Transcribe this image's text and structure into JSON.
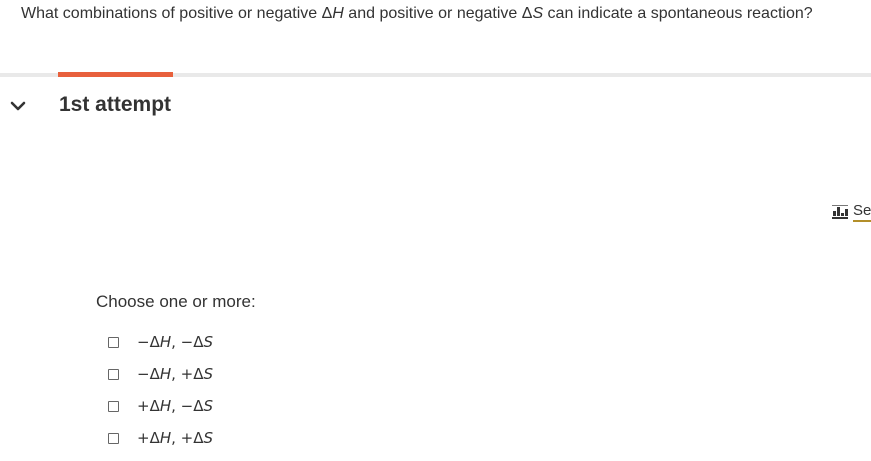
{
  "question": {
    "part1": "What combinations of positive or negative Δ",
    "var_h": "H",
    "part2": " and positive or negative Δ",
    "var_s": "S",
    "part3": " can indicate a spontaneous reaction?"
  },
  "attempt": {
    "title": "1st attempt",
    "expanded_icon": "chevron-down-icon"
  },
  "side_link": {
    "label": "Se",
    "icon": "chart-icon"
  },
  "choices": {
    "instruction": "Choose one or more:",
    "options": [
      {
        "sign_h": "−Δ",
        "h": "H",
        "sep": ", ",
        "sign_s": "−Δ",
        "s": "S",
        "checked": false
      },
      {
        "sign_h": "−Δ",
        "h": "H",
        "sep": ", ",
        "sign_s": "+Δ",
        "s": "S",
        "checked": false
      },
      {
        "sign_h": "+Δ",
        "h": "H",
        "sep": ", ",
        "sign_s": "−Δ",
        "s": "S",
        "checked": false
      },
      {
        "sign_h": "+Δ",
        "h": "H",
        "sep": ", ",
        "sign_s": "+Δ",
        "s": "S",
        "checked": false
      }
    ]
  },
  "colors": {
    "accent": "#e8603c",
    "divider": "#e9e9e9",
    "link_underline": "#b38f2a",
    "text": "#333333"
  }
}
